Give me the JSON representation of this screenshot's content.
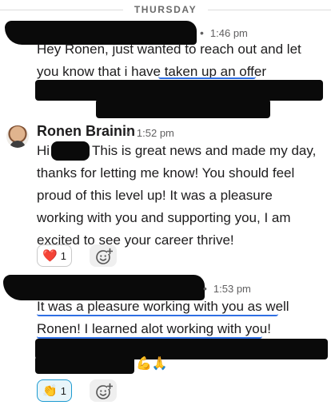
{
  "day_divider": {
    "label": "THURSDAY"
  },
  "messages": [
    {
      "time": "1:46 pm",
      "lines": [
        "Hey Ronen, just wanted to reach out and let",
        "you know that i have taken up an offer"
      ]
    },
    {
      "author": "Ronen Brainin",
      "time": "1:52 pm",
      "greeting": "Hi",
      "first_line_rest": "This is great news and made my day,",
      "lines": [
        "thanks for letting me know! You should feel",
        "proud of this level up! It was a pleasure",
        "working with you and supporting you, I am",
        "excited to see your career thrive!"
      ],
      "reactions": [
        {
          "emoji": "❤️",
          "icon": "red-heart-icon",
          "count": "1"
        }
      ]
    },
    {
      "time": "1:53 pm",
      "lines": [
        "It was a pleasure working with you as well",
        "Ronen! I learned alot working with you!"
      ],
      "trailing_emojis": "💪🙏",
      "reactions": [
        {
          "emoji": "👏",
          "icon": "clapping-hands-icon",
          "count": "1"
        }
      ]
    }
  ],
  "colors": {
    "redaction": "#0a0a0a",
    "spellcheck_underline": "#2f6fe4",
    "reaction_border": "#1d9bd1"
  }
}
